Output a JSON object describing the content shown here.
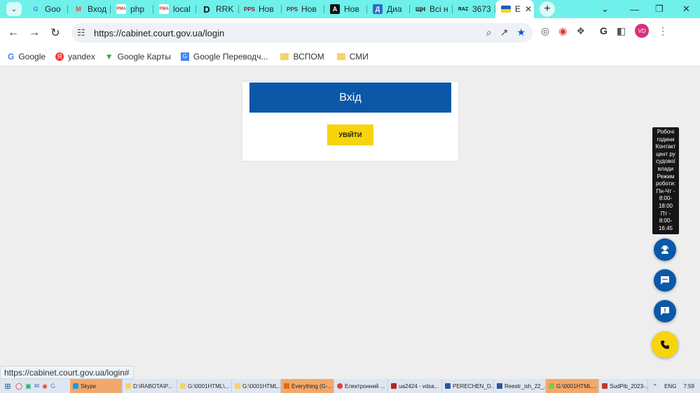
{
  "browser": {
    "tabs": [
      {
        "title": "Goo",
        "icon": "google-icon",
        "color": "#4285f4"
      },
      {
        "title": "Вход",
        "icon": "gmail-icon",
        "color": "#ea4335"
      },
      {
        "title": "php",
        "icon": "pma-icon",
        "color": "#c33"
      },
      {
        "title": "local",
        "icon": "pma-icon",
        "color": "#c33"
      },
      {
        "title": "RRK",
        "icon": "d-logo-icon",
        "color": "#111"
      },
      {
        "title": "Нов",
        "icon": "pps-icon",
        "color": "#8a1c3a"
      },
      {
        "title": "Нов",
        "icon": "pps-icon",
        "color": "#8a1c3a"
      },
      {
        "title": "Нов",
        "icon": "a-logo-icon",
        "color": "#111"
      },
      {
        "title": "Диа",
        "icon": "d-square-icon",
        "color": "#2b6cd3"
      },
      {
        "title": "Всі н",
        "icon": "shch-icon",
        "color": "#111"
      },
      {
        "title": "3673",
        "icon": "raz-icon",
        "color": "#111"
      },
      {
        "title": "E",
        "icon": "ukraine-flag-icon",
        "color": "#1a5cbc",
        "active": true
      }
    ],
    "url": "https://cabinet.court.gov.ua/login",
    "profile_initials": "VD",
    "bookmarks": [
      {
        "label": "Google",
        "icon": "google-icon"
      },
      {
        "label": "yandex",
        "icon": "yandex-icon"
      },
      {
        "label": "Google Карты",
        "icon": "maps-pin-icon"
      },
      {
        "label": "Google Переводч...",
        "icon": "translate-icon"
      },
      {
        "label": "ВСПОМ",
        "icon": "folder-icon"
      },
      {
        "label": "СМИ",
        "icon": "folder-icon"
      }
    ]
  },
  "page": {
    "header": "Вхід",
    "login_button": "УВІЙТИ",
    "tooltip_lines": [
      "Робочі",
      "години",
      "Контакт",
      "цент ру",
      "судової",
      "влади",
      "Режим",
      "роботи:",
      "Пн-Чт -",
      "8:00-",
      "18:00",
      "Пт -",
      "8:00-",
      "16:45"
    ],
    "accent_blue": "#0b57a8",
    "accent_yellow": "#f7d40b"
  },
  "status_url": "https://cabinet.court.gov.ua/login#",
  "taskbar": {
    "items": [
      {
        "label": "Skype",
        "highlight": true
      },
      {
        "label": "D:\\RABOTA\\P..."
      },
      {
        "label": "G:\\0001HTML\\..."
      },
      {
        "label": "G:\\0001HTML..."
      },
      {
        "label": "Everything (G-...",
        "highlight": true
      },
      {
        "label": "Електронний ..."
      },
      {
        "label": "ua2424 - vdsa..."
      },
      {
        "label": "PERECHEN_D..."
      },
      {
        "label": "Reestr_ish_22_..."
      },
      {
        "label": "G:\\0001HTML...",
        "highlight": true
      },
      {
        "label": "SudPib_2023-..."
      }
    ],
    "lang": "ENG",
    "time": "7:59"
  }
}
